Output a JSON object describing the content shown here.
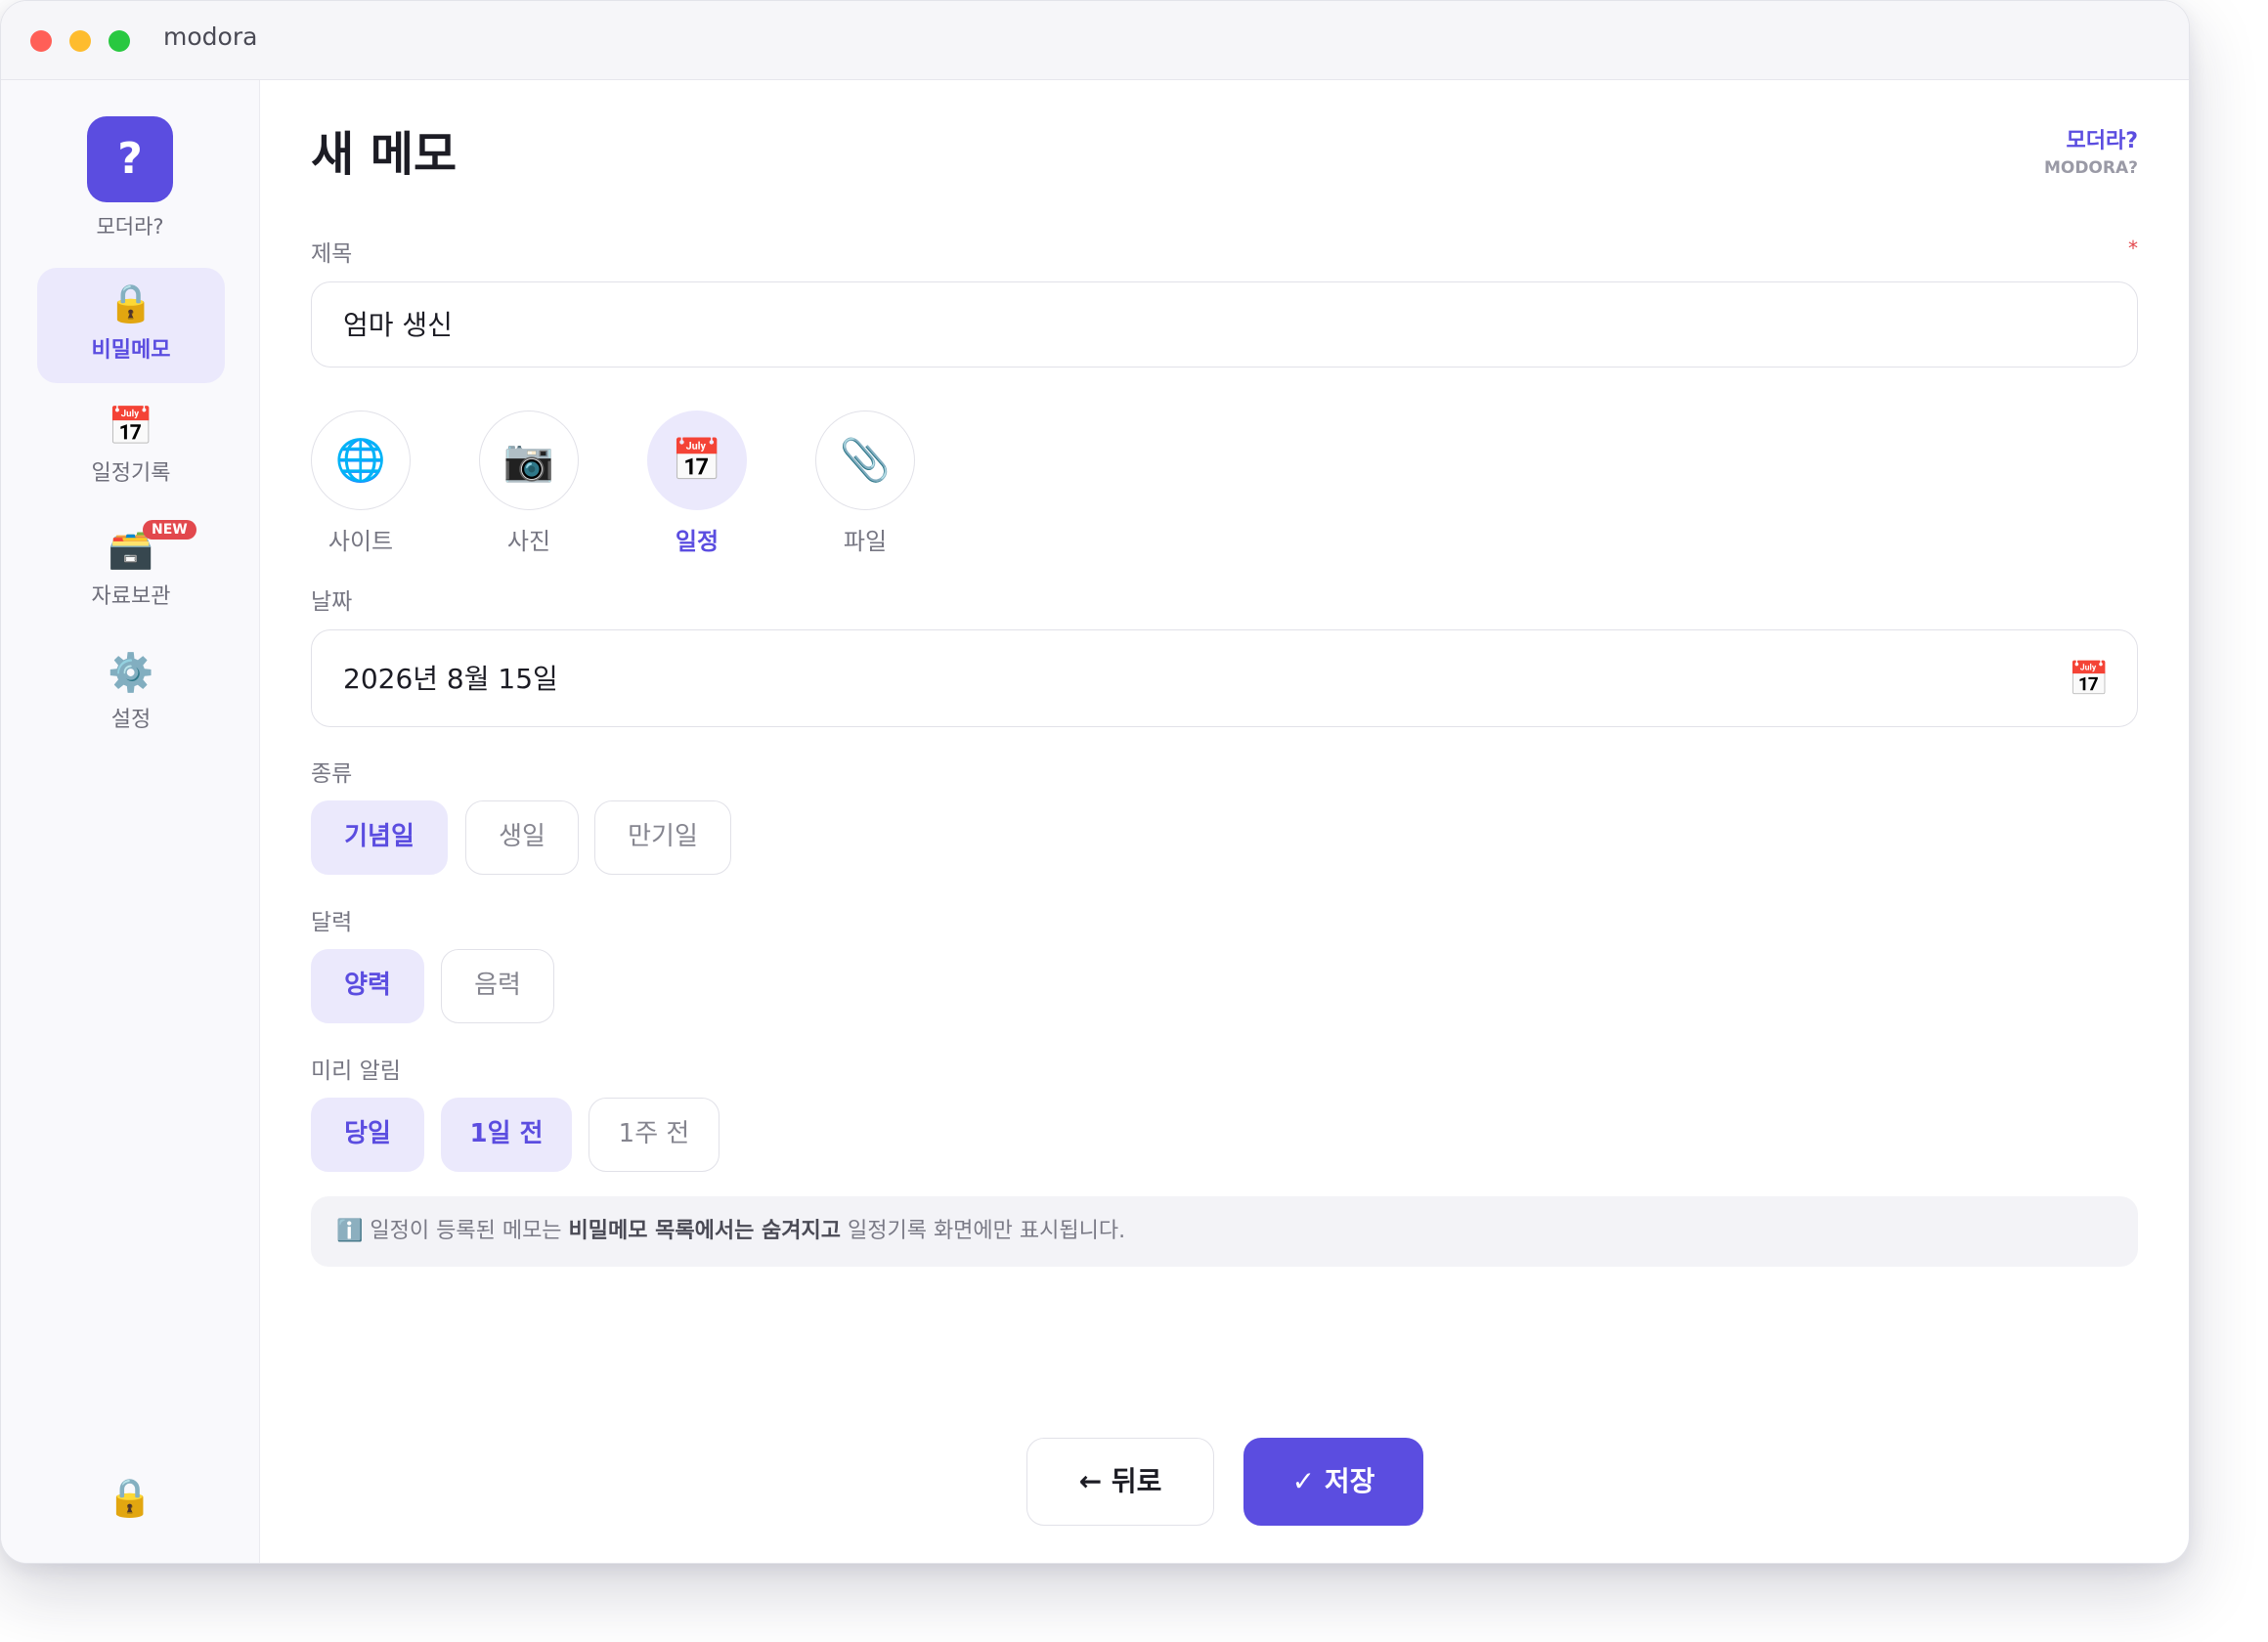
{
  "window": {
    "app_title": "modora"
  },
  "sidebar": {
    "logo": {
      "icon": "?",
      "label": "모더라?"
    },
    "items": [
      {
        "label": "비밀메모",
        "icon": "🔒",
        "icon_name": "lock-icon",
        "active": true
      },
      {
        "label": "일정기록",
        "icon": "📅",
        "icon_name": "calendar-icon",
        "active": false
      },
      {
        "label": "자료보관",
        "icon": "🗃️",
        "icon_name": "archive-box-icon",
        "badge": "NEW",
        "active": false
      },
      {
        "label": "설정",
        "icon": "⚙️",
        "icon_name": "gear-icon",
        "active": false
      }
    ],
    "bottom_icon": "🔒"
  },
  "header": {
    "title": "새 메모",
    "help": {
      "ko": "모더라?",
      "en": "MODORA?"
    }
  },
  "form": {
    "title_label": "제목",
    "required_mark": "*",
    "title_value": "엄마 생신",
    "types": [
      {
        "label": "사이트",
        "icon": "🌐",
        "icon_name": "globe-icon",
        "active": false
      },
      {
        "label": "사진",
        "icon": "📷",
        "icon_name": "camera-icon",
        "active": false
      },
      {
        "label": "일정",
        "icon": "📅",
        "icon_name": "calendar-icon",
        "active": true
      },
      {
        "label": "파일",
        "icon": "📎",
        "icon_name": "paperclip-icon",
        "active": false
      }
    ],
    "date_label": "날짜",
    "date_value": "2026년 8월 15일",
    "date_icon": "📅",
    "kind_label": "종류",
    "kinds": [
      {
        "label": "기념일",
        "active": true
      },
      {
        "label": "생일",
        "active": false
      },
      {
        "label": "만기일",
        "active": false
      }
    ],
    "calendar_label": "달력",
    "calendars": [
      {
        "label": "양력",
        "active": true
      },
      {
        "label": "음력",
        "active": false
      }
    ],
    "alert_label": "미리 알림",
    "alerts": [
      {
        "label": "당일",
        "active": true
      },
      {
        "label": "1일 전",
        "active": true
      },
      {
        "label": "1주 전",
        "active": false
      }
    ],
    "info": {
      "icon": "ℹ️",
      "text_pre": " 일정이 등록된 메모는 ",
      "text_bold": "비밀메모 목록에서는 숨겨지고",
      "text_post": " 일정기록 화면에만 표시됩니다."
    }
  },
  "actions": {
    "back_label": "← 뒤로",
    "save_label": "✓ 저장"
  },
  "colors": {
    "accent": "#5b4de0",
    "accent_soft": "#ebe9fc",
    "badge": "#e2484d"
  }
}
